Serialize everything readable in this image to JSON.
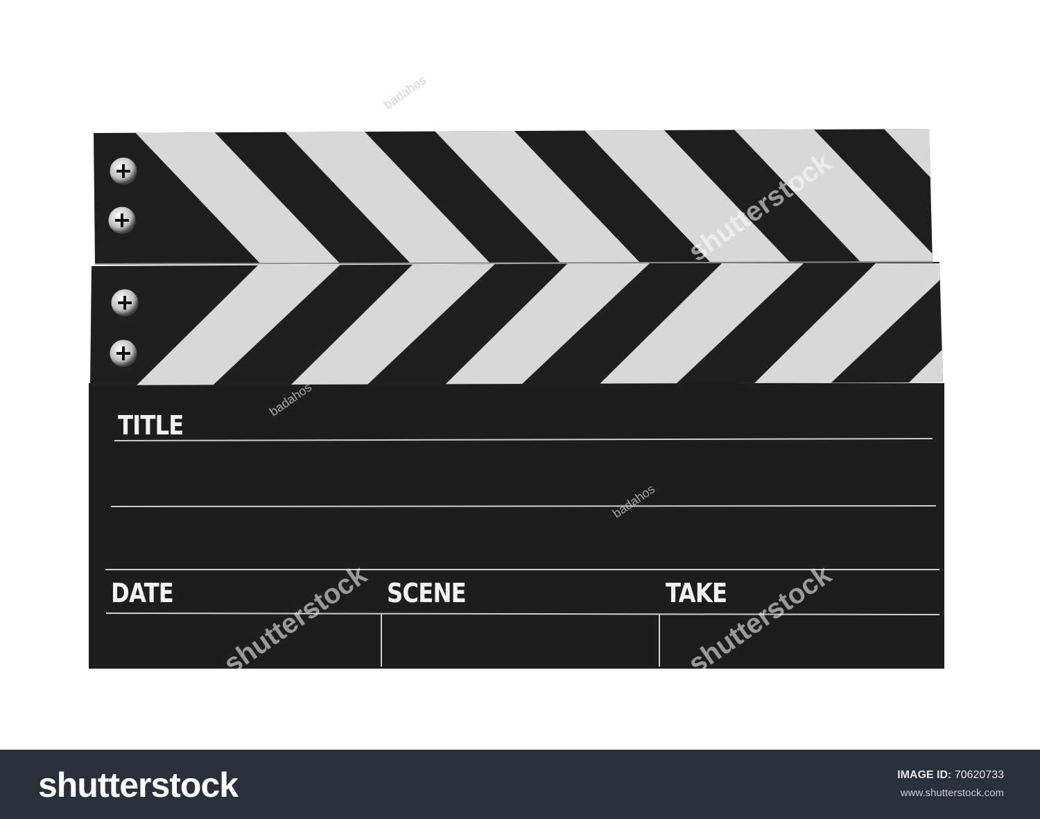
{
  "clapperboard": {
    "labels": {
      "title": "TITLE",
      "date": "DATE",
      "scene": "SCENE",
      "take": "TAKE"
    },
    "colors": {
      "board": "#1c1c1c",
      "stripe": "#d9d9d9",
      "line": "#cfcfcf"
    }
  },
  "watermarks": {
    "brand": "shutterstock",
    "contributor": "badahos"
  },
  "footer": {
    "logo": "shutterstock",
    "image_id_label": "IMAGE ID:",
    "image_id": "70620733",
    "website": "www.shutterstock.com",
    "background": "#2a2f3a"
  }
}
